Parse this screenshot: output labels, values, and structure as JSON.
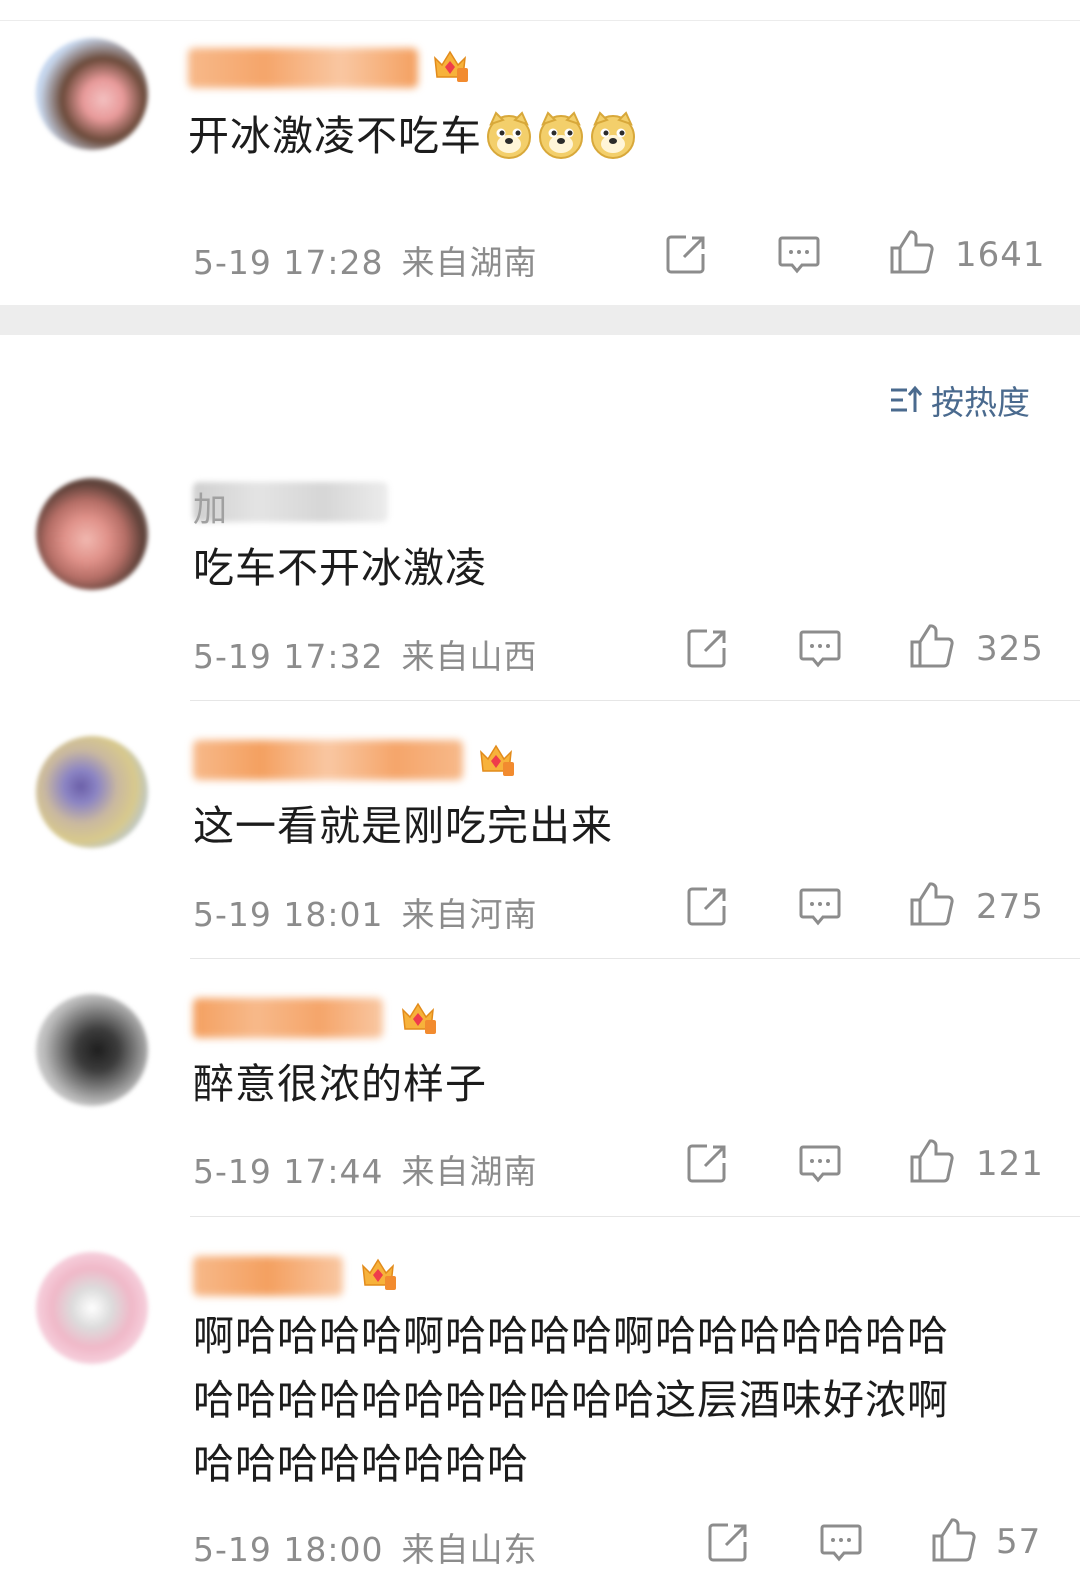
{
  "sort": {
    "label": "按热度"
  },
  "colors": {
    "meta_gray": "#8c8c8c",
    "sort_blue": "#4a6a8e",
    "username_orange": "#f5b07a"
  },
  "comments": [
    {
      "username": "",
      "text": "开冰激凌不吃车",
      "emoji": [
        "doge-emoji",
        "doge-emoji",
        "doge-emoji"
      ],
      "badge_level": "6",
      "time": "5-19 17:28",
      "location": "来自湖南",
      "likes": "1641"
    },
    {
      "username": "加",
      "text": "吃车不开冰激凌",
      "emoji": [],
      "badge_level": "",
      "time": "5-19 17:32",
      "location": "来自山西",
      "likes": "325"
    },
    {
      "username": "",
      "text": "这一看就是刚吃完出来",
      "emoji": [],
      "badge_level": "6",
      "time": "5-19 18:01",
      "location": "来自河南",
      "likes": "275"
    },
    {
      "username": "",
      "text": "醉意很浓的样子",
      "emoji": [],
      "badge_level": "4",
      "time": "5-19 17:44",
      "location": "来自湖南",
      "likes": "121"
    },
    {
      "username": "",
      "text": "啊哈哈哈哈啊哈哈哈哈啊哈哈哈哈哈哈哈\n哈哈哈哈哈哈哈哈哈哈哈这层酒味好浓啊\n哈哈哈哈哈哈哈哈",
      "emoji": [],
      "badge_level": "7",
      "time": "5-19 18:00",
      "location": "来自山东",
      "likes": "57"
    }
  ]
}
